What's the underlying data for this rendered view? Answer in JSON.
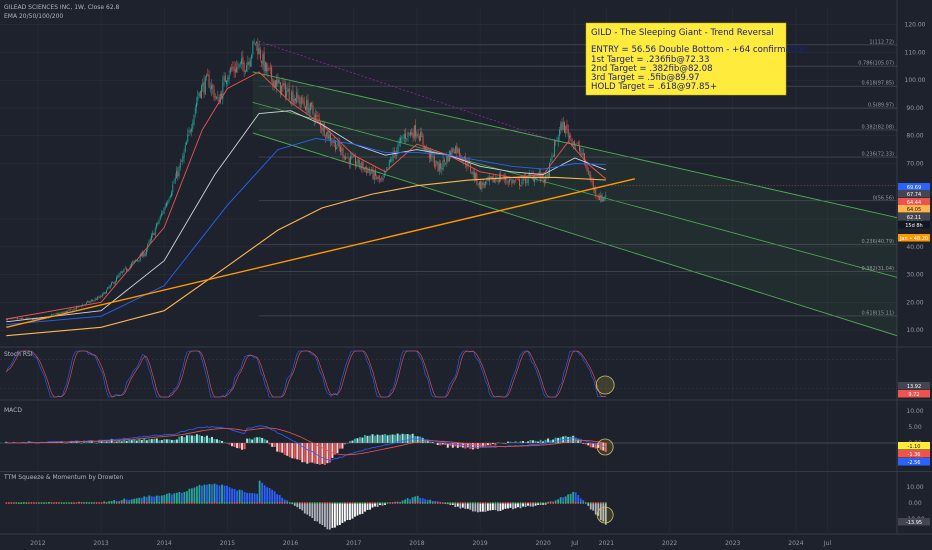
{
  "header": {
    "symbol_line": "GILEAD SCIENCES INC, 1W, Close 62.8",
    "ema_line": "EMA 20/50/100/200"
  },
  "indicators": {
    "stoch_label": "Stoch RSI",
    "macd_label": "MACD",
    "ttm_label": "TTM Squeeze & Momentum by Drowten"
  },
  "annotation": {
    "title": "GILD - The Sleeping Giant - Trend Reversal",
    "lines": [
      "ENTRY = 56.56 Double Bottom - +64 confirmation",
      "1st Target = .236fib@72.33",
      "2nd Target = .382fib@82.08",
      "3rd Target = .5fib@89.97",
      "HOLD Target = .618@97.85+"
    ]
  },
  "colors": {
    "background": "#1e222d",
    "up": "#26a69a",
    "down": "#ef5350",
    "ema20": "#ef5350",
    "ema50": "#d1d4dc",
    "ema100": "#2962ff",
    "ema200": "#ffb74d",
    "trendline": "#ff9800",
    "channel": "#4caf50",
    "annotation_bg": "#ffeb3b",
    "annotation_text": "#1a237e"
  },
  "chart_data": {
    "type": "candlestick",
    "x_labels": [
      "2012",
      "2013",
      "2014",
      "2015",
      "2016",
      "2017",
      "2018",
      "2019",
      "2020",
      "Jul",
      "2021",
      "2022",
      "2023",
      "2024",
      "Jul"
    ],
    "y_ticks": [
      {
        "value": 120.0,
        "label": "120.00"
      },
      {
        "value": 110.0,
        "label": "110.00"
      },
      {
        "value": 100.0,
        "label": "100.00"
      },
      {
        "value": 90.0,
        "label": "90.00"
      },
      {
        "value": 80.0,
        "label": "80.00"
      },
      {
        "value": 70.0,
        "label": "70.00"
      },
      {
        "value": 50.0,
        "label": "50.00"
      },
      {
        "value": 40.0,
        "label": "40.00"
      },
      {
        "value": 30.0,
        "label": "30.00"
      },
      {
        "value": 20.0,
        "label": "20.00"
      },
      {
        "value": 10.0,
        "label": "10.00"
      }
    ],
    "fib_levels": [
      {
        "value": 112.72,
        "label": "1(112.72)"
      },
      {
        "value": 105.07,
        "label": "0.786(105.07)"
      },
      {
        "value": 97.85,
        "label": "0.618(97.85)"
      },
      {
        "value": 89.97,
        "label": "0.5(89.97)"
      },
      {
        "value": 82.08,
        "label": "0.382(82.08)"
      },
      {
        "value": 72.33,
        "label": "0.236(72.33)"
      },
      {
        "value": 56.56,
        "label": "0(56.56)"
      },
      {
        "value": 40.79,
        "label": "0.236(40.79)"
      },
      {
        "value": 31.04,
        "label": "0.382(31.04)"
      },
      {
        "value": 15.11,
        "label": "0.618(15.11)"
      }
    ],
    "price_labels": [
      {
        "value": 69.69,
        "label": "69.69",
        "color": "#2962ff"
      },
      {
        "value": 67.74,
        "label": "67.74",
        "color": "#434651"
      },
      {
        "value": 64.44,
        "label": "64.44",
        "color": "#ef5350"
      },
      {
        "value": 64.05,
        "label": "64.05",
        "color": "#ffb74d"
      },
      {
        "value": 62.11,
        "label": "62.11",
        "color": "#434651"
      },
      {
        "value": 59.8,
        "label": "15d 8h",
        "color": "#131722"
      },
      {
        "value": 48.2,
        "label": "Jan • 48.20",
        "color": "#ff9800"
      }
    ],
    "y_range": [
      5,
      126
    ],
    "x_range": [
      2011.4,
      2025.6
    ],
    "candles": {
      "anchors": [
        [
          2011.5,
          14
        ],
        [
          2012.0,
          14
        ],
        [
          2012.5,
          17
        ],
        [
          2013.0,
          22
        ],
        [
          2013.3,
          30
        ],
        [
          2013.7,
          38
        ],
        [
          2014.0,
          54
        ],
        [
          2014.3,
          72
        ],
        [
          2014.55,
          96
        ],
        [
          2014.7,
          100
        ],
        [
          2014.85,
          92
        ],
        [
          2015.0,
          103
        ],
        [
          2015.3,
          106
        ],
        [
          2015.45,
          114
        ],
        [
          2015.6,
          104
        ],
        [
          2015.8,
          98
        ],
        [
          2016.0,
          95
        ],
        [
          2016.3,
          90
        ],
        [
          2016.6,
          80
        ],
        [
          2016.9,
          72
        ],
        [
          2017.2,
          68
        ],
        [
          2017.45,
          63
        ],
        [
          2017.6,
          72
        ],
        [
          2017.8,
          80
        ],
        [
          2018.0,
          82
        ],
        [
          2018.15,
          75
        ],
        [
          2018.35,
          68
        ],
        [
          2018.6,
          76
        ],
        [
          2018.8,
          70
        ],
        [
          2019.0,
          62
        ],
        [
          2019.3,
          65
        ],
        [
          2019.6,
          63
        ],
        [
          2019.9,
          66
        ],
        [
          2020.05,
          64
        ],
        [
          2020.2,
          78
        ],
        [
          2020.3,
          84
        ],
        [
          2020.45,
          79
        ],
        [
          2020.6,
          74
        ],
        [
          2020.8,
          61
        ],
        [
          2020.92,
          57
        ],
        [
          2020.99,
          59
        ]
      ],
      "count": 480
    },
    "emas": [
      {
        "name": "EMA 20",
        "color": "#ef5350",
        "points": [
          [
            2011.5,
            14
          ],
          [
            2013.0,
            20
          ],
          [
            2014.0,
            47
          ],
          [
            2014.6,
            82
          ],
          [
            2015.0,
            97
          ],
          [
            2015.5,
            103
          ],
          [
            2016.0,
            92
          ],
          [
            2016.5,
            84
          ],
          [
            2017.0,
            73
          ],
          [
            2017.5,
            67
          ],
          [
            2018.0,
            77
          ],
          [
            2018.5,
            73
          ],
          [
            2019.0,
            67
          ],
          [
            2019.5,
            65
          ],
          [
            2020.0,
            66
          ],
          [
            2020.4,
            78
          ],
          [
            2020.7,
            70
          ],
          [
            2020.99,
            64.44
          ]
        ]
      },
      {
        "name": "EMA 50",
        "color": "#d1d4dc",
        "points": [
          [
            2011.5,
            13
          ],
          [
            2013.0,
            17
          ],
          [
            2014.0,
            35
          ],
          [
            2014.8,
            66
          ],
          [
            2015.5,
            88
          ],
          [
            2016.0,
            89
          ],
          [
            2016.5,
            84
          ],
          [
            2017.0,
            77
          ],
          [
            2017.5,
            73
          ],
          [
            2018.0,
            75
          ],
          [
            2018.5,
            73
          ],
          [
            2019.0,
            69
          ],
          [
            2019.5,
            67
          ],
          [
            2020.0,
            66
          ],
          [
            2020.5,
            72
          ],
          [
            2020.99,
            67.74
          ]
        ]
      },
      {
        "name": "EMA 100",
        "color": "#2962ff",
        "points": [
          [
            2011.5,
            12
          ],
          [
            2013.0,
            15
          ],
          [
            2014.0,
            26
          ],
          [
            2015.0,
            55
          ],
          [
            2015.8,
            75
          ],
          [
            2016.4,
            79
          ],
          [
            2017.0,
            77
          ],
          [
            2017.5,
            74
          ],
          [
            2018.0,
            74
          ],
          [
            2018.5,
            73
          ],
          [
            2019.0,
            71
          ],
          [
            2019.5,
            69
          ],
          [
            2020.0,
            68
          ],
          [
            2020.5,
            70
          ],
          [
            2020.99,
            69.69
          ]
        ]
      },
      {
        "name": "EMA 200",
        "color": "#ffb74d",
        "points": [
          [
            2011.5,
            8
          ],
          [
            2013.0,
            11
          ],
          [
            2014.0,
            17
          ],
          [
            2015.0,
            33
          ],
          [
            2015.8,
            46
          ],
          [
            2016.5,
            54
          ],
          [
            2017.3,
            59
          ],
          [
            2018.0,
            62
          ],
          [
            2018.8,
            64
          ],
          [
            2019.5,
            65
          ],
          [
            2020.2,
            65
          ],
          [
            2020.99,
            64.05
          ]
        ]
      }
    ],
    "trendline": {
      "color": "#ff9800",
      "from": [
        2011.5,
        11
      ],
      "to": [
        2021.45,
        64.5
      ]
    },
    "channel": {
      "upper_from": [
        2015.4,
        103
      ],
      "upper_to": [
        2025.6,
        50.5
      ],
      "lower_from": [
        2015.4,
        81
      ],
      "lower_to": [
        2025.6,
        8
      ],
      "mid_from": [
        2015.4,
        92
      ],
      "mid_to": [
        2025.6,
        29
      ]
    },
    "dotted_line": {
      "from": [
        2015.5,
        114
      ],
      "to": [
        2020.2,
        78
      ]
    }
  },
  "stoch": {
    "value_labels": [
      {
        "label": "13.92",
        "color": "#434651"
      },
      {
        "label": "9.72",
        "color": "#ef5350"
      }
    ]
  },
  "macd": {
    "y_ticks": [
      "10.00",
      "5.00",
      "0.00",
      "-5.00"
    ],
    "value_labels": [
      {
        "label": "-1.10",
        "color": "#ffeb3b"
      },
      {
        "label": "-1.36",
        "color": "#ef5350"
      },
      {
        "label": "-2.56",
        "color": "#2962ff"
      }
    ]
  },
  "ttm": {
    "y_ticks": [
      "10.00",
      "0.00",
      "-10.00"
    ],
    "value_labels": [
      {
        "label": "-13.95",
        "color": "#434651"
      }
    ]
  }
}
